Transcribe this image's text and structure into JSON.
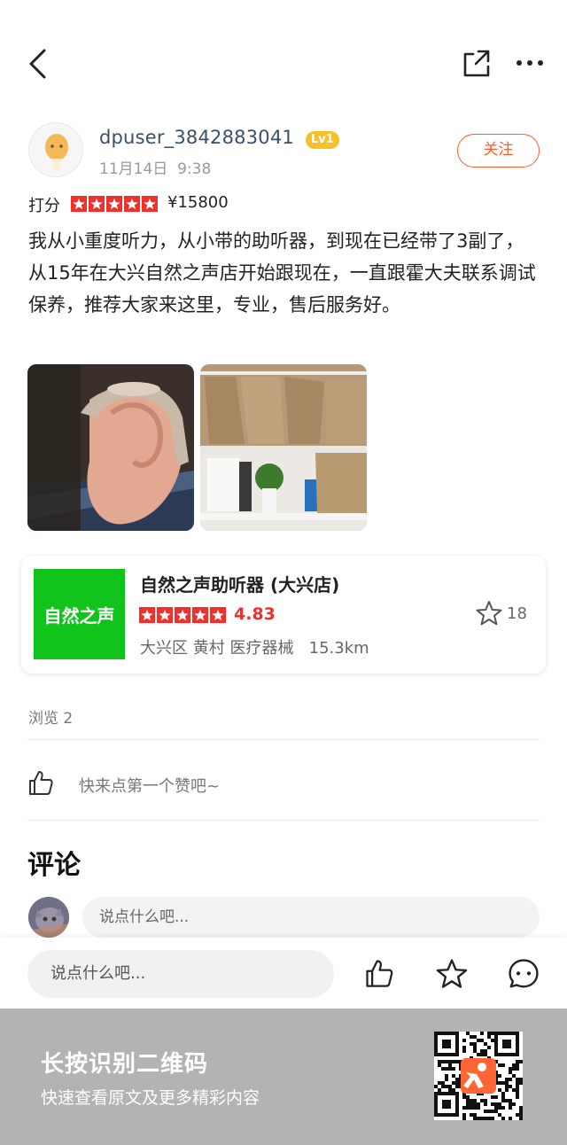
{
  "header": {
    "back_icon": "chevron-left-icon",
    "share_icon": "share-icon",
    "more_icon": "more-icon"
  },
  "author": {
    "username": "dpuser_3842883041",
    "level": "Lv1",
    "date": "11月14日",
    "time": "9:38",
    "follow_label": "关注"
  },
  "review": {
    "score_label": "打分",
    "stars": 5,
    "price": "¥15800",
    "text": "我从小重度听力，从小带的助听器，到现在已经带了3副了，从15年在大兴自然之声店开始跟现在，一直跟霍大夫联系调试保养，推荐大家来这里，专业，售后服务好。"
  },
  "shop": {
    "logo_text": "自然之声",
    "name": "自然之声助听器 (大兴店)",
    "rating": "4.83",
    "stars": 5,
    "district": "大兴区",
    "area": "黄村",
    "category": "医疗器械",
    "distance": "15.3km",
    "favorites": "18"
  },
  "stats": {
    "views": "浏览 2",
    "like_prompt": "快来点第一个赞吧~"
  },
  "comments": {
    "title": "评论",
    "placeholder": "说点什么吧..."
  },
  "bottom_bar": {
    "placeholder": "说点什么吧...",
    "icons": [
      "thumbs-up-icon",
      "star-icon",
      "comment-icon"
    ]
  },
  "qr_footer": {
    "title": "长按识别二维码",
    "subtitle": "快速查看原文及更多精彩内容"
  },
  "colors": {
    "accent": "#ff5d2b",
    "star_red": "#f0302a",
    "shop_green": "#10c41b",
    "level_yellow": "#f5c02a",
    "footer_gray": "#b3b3b3"
  }
}
